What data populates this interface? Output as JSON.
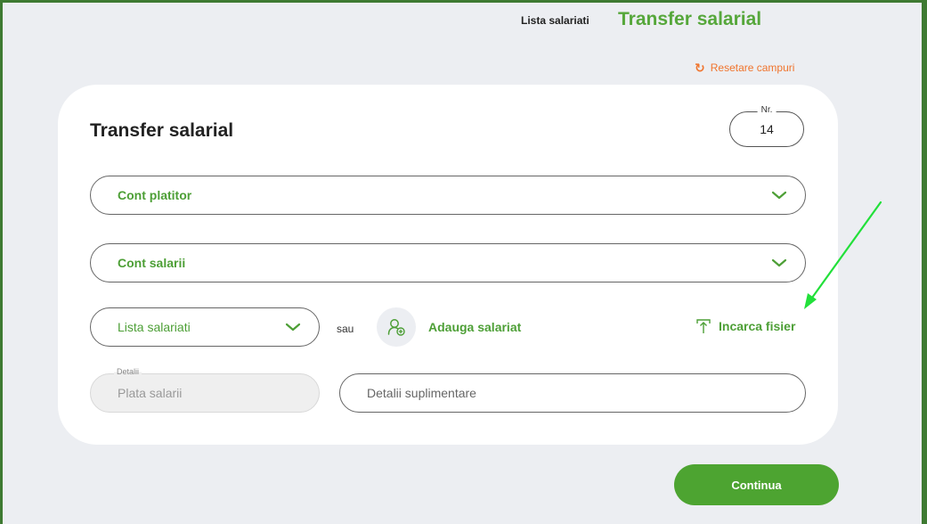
{
  "nav": {
    "employees_list": "Lista salariati",
    "active": "Transfer salarial"
  },
  "reset": {
    "label": "Resetare campuri",
    "icon": "refresh-icon"
  },
  "form": {
    "title": "Transfer salarial",
    "nr": {
      "label": "Nr.",
      "value": "14"
    },
    "payer_account": {
      "label": "Cont platitor"
    },
    "salary_account": {
      "label": "Cont salarii"
    },
    "employees_list": {
      "label": "Lista salariati"
    },
    "or_text": "sau",
    "add_employee": {
      "label": "Adauga salariat",
      "icon": "add-user-icon"
    },
    "upload": {
      "label": "Incarca fisier",
      "icon": "upload-icon"
    },
    "details": {
      "label": "Detalii",
      "value": "Plata salarii"
    },
    "extra_details": {
      "placeholder": "Detalii suplimentare"
    }
  },
  "continue_label": "Continua",
  "colors": {
    "brand_green": "#4da431",
    "accent_orange": "#f0742d",
    "annotation_arrow": "#22e03a",
    "frame": "#3e7a32"
  }
}
